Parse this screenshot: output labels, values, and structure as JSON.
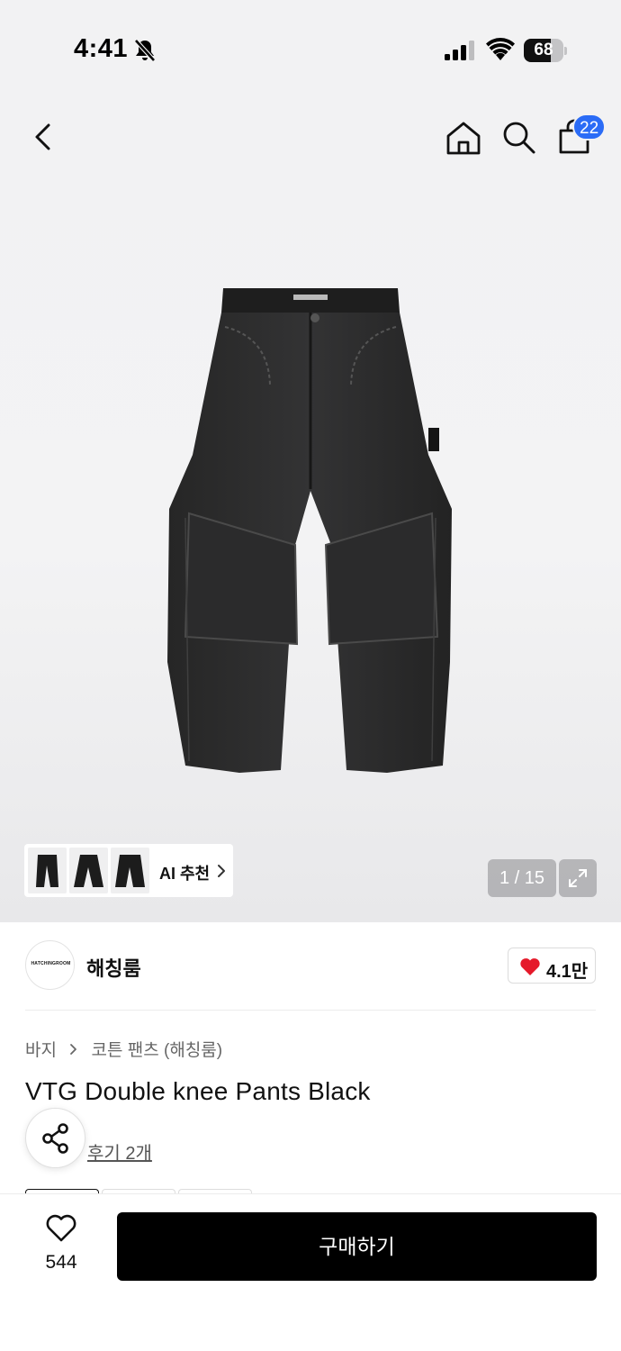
{
  "status_bar": {
    "time": "4:41",
    "battery": "68",
    "battery_level": 0.68
  },
  "nav": {
    "cart_badge": "22",
    "icons": [
      "back-icon",
      "home-icon",
      "search-icon",
      "cart-icon"
    ]
  },
  "gallery": {
    "ai_label": "AI 추천",
    "counter": "1 / 15"
  },
  "brand": {
    "logo_text": "HATCHINGROOM",
    "name": "해칭룸",
    "likes": "4.1만"
  },
  "product": {
    "breadcrumb": [
      "바지",
      "코튼 팬츠 (해칭룸)"
    ],
    "title": "VTG Double knee Pants Black",
    "reviews": "후기 2개"
  },
  "bottom": {
    "wish_count": "544",
    "buy_label": "구매하기"
  },
  "colors": {
    "accent_badge": "#2b6cf6",
    "heart": "#e5192a",
    "buy_button": "#000000"
  }
}
